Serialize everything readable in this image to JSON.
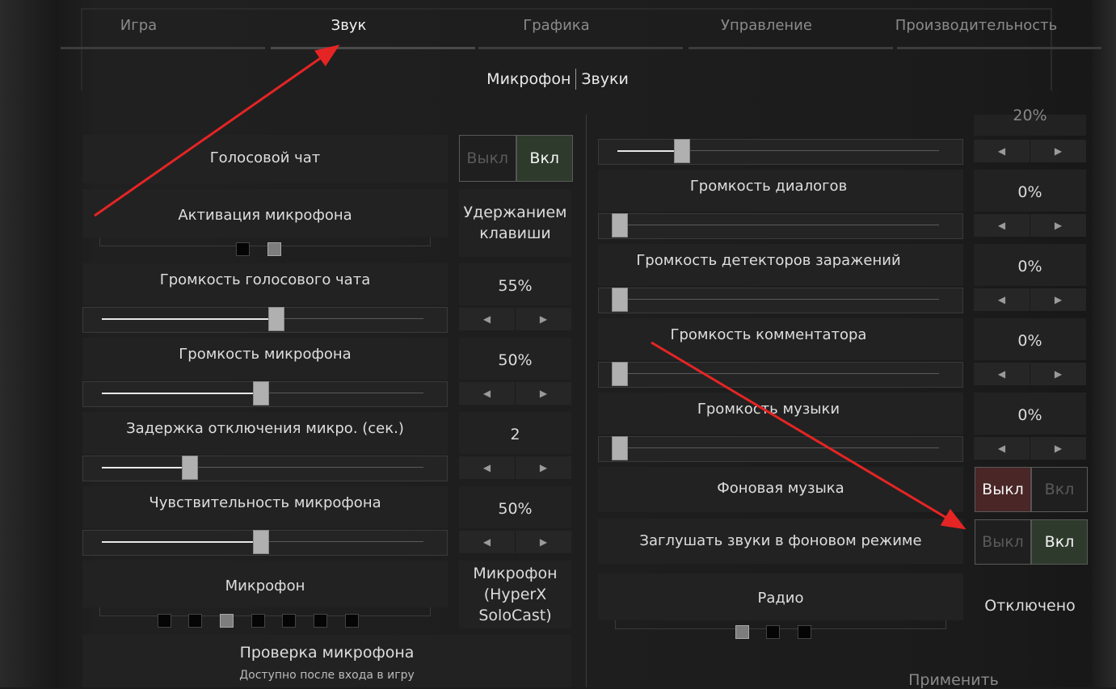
{
  "tabs": [
    {
      "label": "Игра",
      "active": false
    },
    {
      "label": "Звук",
      "active": true
    },
    {
      "label": "Графика",
      "active": false
    },
    {
      "label": "Управление",
      "active": false
    },
    {
      "label": "Производительность",
      "active": false
    }
  ],
  "subnav": {
    "microphone": "Микрофон",
    "sounds": "Звуки"
  },
  "left": {
    "voice_chat": {
      "label": "Голосовой чат",
      "off": "Выкл",
      "on": "Вкл",
      "state": "on"
    },
    "mic_activation": {
      "label": "Активация микрофона",
      "value": "Удержанием клавиши",
      "options_count": 2,
      "selected_index": 1
    },
    "voice_volume": {
      "label": "Громкость голосового чата",
      "value": "55%",
      "level": 0.55
    },
    "mic_volume": {
      "label": "Громкость микрофона",
      "value": "50%",
      "level": 0.5
    },
    "mic_delay": {
      "label": "Задержка отключения микро. (сек.)",
      "value": "2",
      "level": 0.27
    },
    "mic_sensitivity": {
      "label": "Чувствительность микрофона",
      "value": "50%",
      "level": 0.5
    },
    "microphone": {
      "label": "Микрофон",
      "value": "Микрофон (HyperX SoloCast)",
      "options_count": 7,
      "selected_index": 2
    },
    "mic_test": {
      "label": "Проверка микрофона",
      "note": "Доступно после входа в игру"
    }
  },
  "right": {
    "top_value": "20%",
    "top_level": 0.2,
    "dialog_volume": {
      "label": "Громкость диалогов",
      "value": "0%",
      "level": 0
    },
    "detector_volume": {
      "label": "Громкость детекторов заражений",
      "value": "0%",
      "level": 0
    },
    "commentator_volume": {
      "label": "Громкость комментатора",
      "value": "0%",
      "level": 0
    },
    "music_volume": {
      "label": "Громкость музыки",
      "value": "0%",
      "level": 0
    },
    "bg_music": {
      "label": "Фоновая музыка",
      "off": "Выкл",
      "on": "Вкл",
      "state": "off"
    },
    "mute_bg": {
      "label": "Заглушать звуки в фоновом режиме",
      "off": "Выкл",
      "on": "Вкл",
      "state": "on"
    },
    "radio": {
      "label": "Радио",
      "value": "Отключено",
      "options_count": 3,
      "selected_index": 0
    },
    "apply": "Применить"
  },
  "colors": {
    "annotation": "#e52424",
    "toggle_on": "#2e3b2c",
    "toggle_off": "#4a2626"
  }
}
